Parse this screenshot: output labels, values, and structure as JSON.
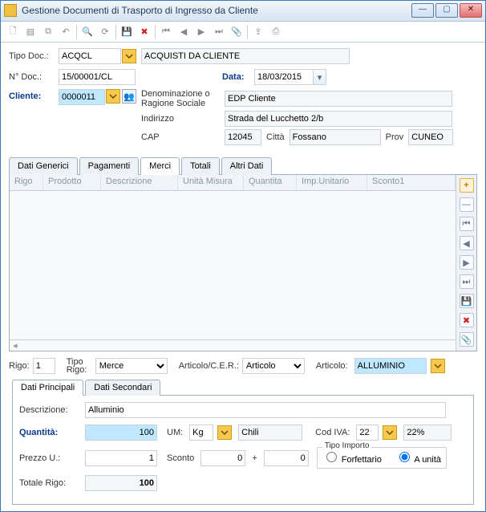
{
  "window": {
    "title": "Gestione Documenti di Trasporto di Ingresso da Cliente"
  },
  "labels": {
    "tipo_doc": "Tipo Doc.:",
    "n_doc": "N° Doc.:",
    "data": "Data:",
    "cliente": "Cliente:",
    "denom": "Denominazione o Ragione Sociale",
    "indirizzo": "Indirizzo",
    "cap": "CAP",
    "citta": "Città",
    "prov": "Prov",
    "rigo": "Rigo:",
    "tipo_rigo": "Tipo Rigo:",
    "articolo_cer": "Articolo/C.E.R.:",
    "articolo": "Articolo:",
    "descrizione": "Descrizione:",
    "quantita": "Quantità:",
    "um": "UM:",
    "cod_iva": "Cod IVA:",
    "prezzo_u": "Prezzo U.:",
    "sconto": "Sconto",
    "plus": "+",
    "totale_rigo": "Totale Rigo:",
    "tipo_importo": "Tipo Importo",
    "forfettario": "Forfettario",
    "a_unita": "A unità"
  },
  "header": {
    "tipo_doc": "ACQCL",
    "tipo_doc_desc": "ACQUISTI DA CLIENTE",
    "n_doc": "15/00001/CL",
    "data": "18/03/2015",
    "cliente_code": "0000011",
    "denom": "EDP Cliente",
    "indirizzo": "Strada del Lucchetto 2/b",
    "cap": "12045",
    "citta": "Fossano",
    "prov": "CUNEO"
  },
  "tabs": {
    "t1": "Dati Generici",
    "t2": "Pagamenti",
    "t3": "Merci",
    "t4": "Totali",
    "t5": "Altri Dati"
  },
  "grid_headers": {
    "rigo": "Rigo",
    "prodotto": "Prodotto",
    "descrizione": "Descrizione",
    "um": "Unità Misura",
    "quantita": "Quantita",
    "imp_unit": "Imp.Unitario",
    "sconto1": "Sconto1"
  },
  "rigo": {
    "num": "1",
    "tipo": "Merce",
    "art_cer": "Articolo",
    "articolo": "ALLUMINIO"
  },
  "subtabs": {
    "s1": "Dati Principali",
    "s2": "Dati Secondari"
  },
  "detail": {
    "descrizione": "Alluminio",
    "quantita": "100",
    "um": "Kg",
    "um_desc": "Chili",
    "cod_iva": "22",
    "iva_desc": "22%",
    "prezzo_u": "1",
    "sconto1": "0",
    "sconto2": "0",
    "totale": "100",
    "tipo_importo": "unita"
  }
}
